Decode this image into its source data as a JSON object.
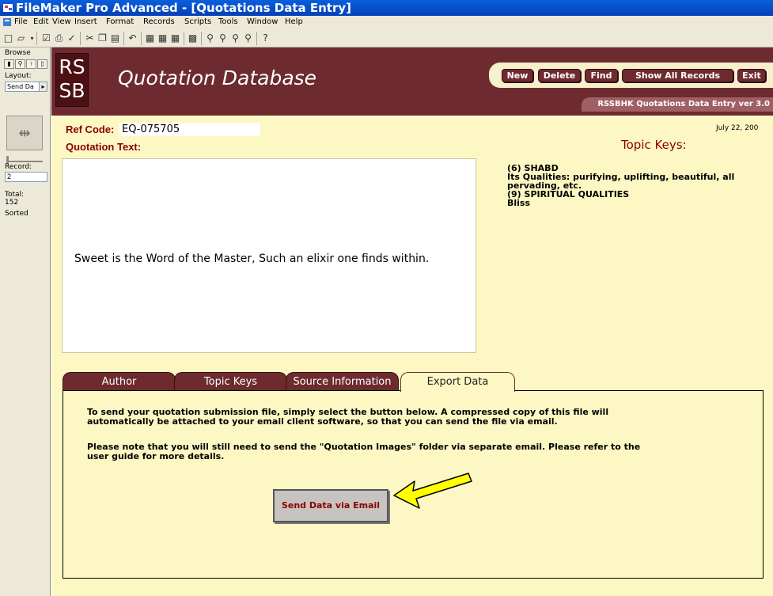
{
  "window": {
    "title": "FileMaker Pro Advanced - [Quotations Data Entry]"
  },
  "menu": [
    "File",
    "Edit",
    "View",
    "Insert",
    "Format",
    "Records",
    "Scripts",
    "Tools",
    "Window",
    "Help"
  ],
  "status_area": {
    "mode": "Browse",
    "layout_label": "Layout:",
    "layout_value": "Send Da",
    "record_label": "Record:",
    "record_value": "2",
    "total_label": "Total:",
    "total_value": "152",
    "sorted_label": "Sorted"
  },
  "header": {
    "logo_line1": "RS",
    "logo_line2": "SB",
    "title": "Quotation Database",
    "buttons": {
      "new": "New",
      "delete": "Delete",
      "find": "Find",
      "show_all": "Show All Records",
      "exit": "Exit"
    },
    "version": "RSSBHK Quotations Data Entry ver 3.0"
  },
  "record": {
    "ref_label": "Ref Code:",
    "ref_code": "EQ-075705",
    "date": "July 22, 200",
    "quote_label": "Quotation Text:",
    "quote_text": "Sweet is the Word of the Master, Such an elixir one finds within.",
    "topic_label": "Topic Keys:",
    "topics": [
      "(6) SHABD",
      "Its Qualities: purifying, uplifting, beautiful, all pervading, etc.",
      "(9) SPIRITUAL QUALITIES",
      "Bliss"
    ]
  },
  "tabs": [
    "Author",
    "Topic Keys",
    "Source Information",
    "Export Data"
  ],
  "active_tab": "Export Data",
  "export": {
    "paragraph1": "To send your quotation submission file, simply select the button below. A compressed copy of this file will automatically be attached to your email client software, so that you can send the file via email.",
    "paragraph2": "Please note that you will still need to send the \"Quotation Images\" folder via separate email.  Please refer to the user guide for more details.",
    "send_button": "Send Data via Email"
  },
  "colors": {
    "header": "#6e2b2f",
    "background": "#fdf8c3",
    "label": "#8b0000",
    "arrow": "#ffff00"
  }
}
